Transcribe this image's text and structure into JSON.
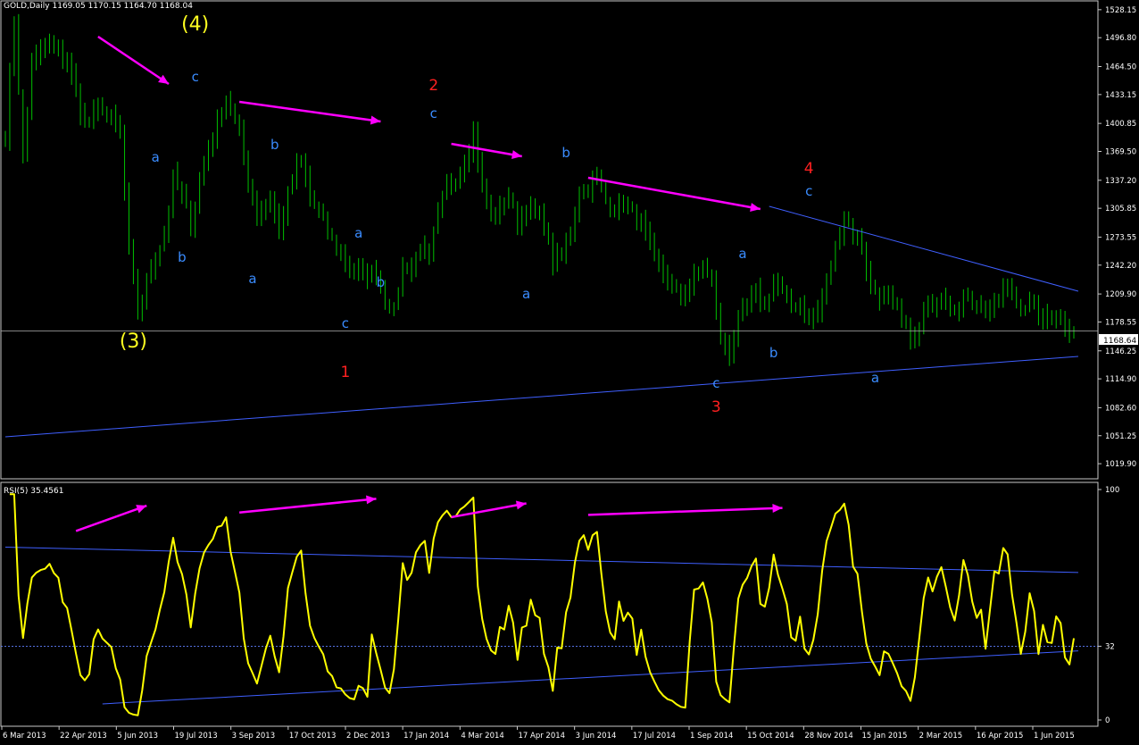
{
  "main_header": "GOLD,Daily  1169.05 1170.15 1164.70 1168.04",
  "rsi_header": "RSI(5) 35.4561",
  "current_price_label": "1168.64",
  "colors": {
    "background": "#000000",
    "candles": "#00c000",
    "rsi_line": "#ffff00",
    "trend_lines": "#3f5fff",
    "arrows": "#ff00ff",
    "wave_blue": "#3a8cff",
    "wave_red": "#ff2020",
    "wave_yellow": "#ffff20",
    "axis_text": "#ffffff",
    "frame": "#c8c8c8"
  },
  "chart_data": [
    {
      "type": "candlestick",
      "title": "GOLD,Daily",
      "y_ticks": [
        "1528.15",
        "1496.80",
        "1464.50",
        "1433.15",
        "1400.85",
        "1369.50",
        "1337.20",
        "1305.85",
        "1273.55",
        "1242.20",
        "1209.90",
        "1178.55",
        "1146.25",
        "1114.90",
        "1082.60",
        "1051.25",
        "1019.90"
      ],
      "ylim": [
        1004,
        1536
      ],
      "x_ticks": [
        "6 Mar 2013",
        "22 Apr 2013",
        "5 Jun 2013",
        "19 Jul 2013",
        "3 Sep 2013",
        "17 Oct 2013",
        "2 Dec 2013",
        "17 Jan 2014",
        "4 Mar 2014",
        "17 Apr 2014",
        "3 Jun 2014",
        "17 Jul 2014",
        "1 Sep 2014",
        "15 Oct 2014",
        "28 Nov 2014",
        "15 Jan 2015",
        "2 Mar 2015",
        "16 Apr 2015",
        "1 Jun 2015"
      ],
      "price_path": [
        [
          0,
          1390
        ],
        [
          2,
          1520
        ],
        [
          4,
          1360
        ],
        [
          6,
          1470
        ],
        [
          10,
          1490
        ],
        [
          14,
          1470
        ],
        [
          18,
          1400
        ],
        [
          22,
          1420
        ],
        [
          26,
          1390
        ],
        [
          28,
          1260
        ],
        [
          30,
          1190
        ],
        [
          33,
          1240
        ],
        [
          36,
          1275
        ],
        [
          38,
          1340
        ],
        [
          40,
          1320
        ],
        [
          42,
          1290
        ],
        [
          45,
          1360
        ],
        [
          48,
          1400
        ],
        [
          50,
          1430
        ],
        [
          53,
          1390
        ],
        [
          55,
          1340
        ],
        [
          57,
          1300
        ],
        [
          60,
          1320
        ],
        [
          62,
          1280
        ],
        [
          65,
          1340
        ],
        [
          67,
          1360
        ],
        [
          69,
          1320
        ],
        [
          72,
          1290
        ],
        [
          75,
          1260
        ],
        [
          78,
          1240
        ],
        [
          81,
          1230
        ],
        [
          84,
          1235
        ],
        [
          86,
          1205
        ],
        [
          88,
          1190
        ],
        [
          90,
          1240
        ],
        [
          92,
          1240
        ],
        [
          94,
          1265
        ],
        [
          96,
          1250
        ],
        [
          98,
          1300
        ],
        [
          100,
          1330
        ],
        [
          102,
          1340
        ],
        [
          104,
          1360
        ],
        [
          106,
          1390
        ],
        [
          108,
          1330
        ],
        [
          110,
          1300
        ],
        [
          112,
          1305
        ],
        [
          114,
          1320
        ],
        [
          116,
          1290
        ],
        [
          118,
          1305
        ],
        [
          120,
          1300
        ],
        [
          122,
          1290
        ],
        [
          124,
          1245
        ],
        [
          126,
          1255
        ],
        [
          128,
          1280
        ],
        [
          130,
          1325
        ],
        [
          132,
          1330
        ],
        [
          134,
          1340
        ],
        [
          136,
          1315
        ],
        [
          138,
          1305
        ],
        [
          140,
          1310
        ],
        [
          142,
          1300
        ],
        [
          144,
          1290
        ],
        [
          146,
          1260
        ],
        [
          148,
          1240
        ],
        [
          150,
          1230
        ],
        [
          152,
          1210
        ],
        [
          154,
          1210
        ],
        [
          156,
          1230
        ],
        [
          158,
          1240
        ],
        [
          160,
          1225
        ],
        [
          162,
          1160
        ],
        [
          164,
          1145
        ],
        [
          166,
          1180
        ],
        [
          168,
          1200
        ],
        [
          170,
          1210
        ],
        [
          172,
          1195
        ],
        [
          174,
          1225
        ],
        [
          176,
          1210
        ],
        [
          178,
          1195
        ],
        [
          180,
          1200
        ],
        [
          182,
          1180
        ],
        [
          184,
          1190
        ],
        [
          186,
          1220
        ],
        [
          188,
          1260
        ],
        [
          190,
          1300
        ],
        [
          192,
          1280
        ],
        [
          194,
          1260
        ],
        [
          196,
          1220
        ],
        [
          198,
          1210
        ],
        [
          200,
          1205
        ],
        [
          202,
          1190
        ],
        [
          204,
          1170
        ],
        [
          206,
          1160
        ],
        [
          208,
          1185
        ],
        [
          210,
          1200
        ],
        [
          212,
          1210
        ],
        [
          214,
          1200
        ],
        [
          216,
          1195
        ],
        [
          218,
          1210
        ],
        [
          220,
          1200
        ],
        [
          222,
          1190
        ],
        [
          224,
          1200
        ],
        [
          226,
          1215
        ],
        [
          228,
          1210
        ],
        [
          230,
          1195
        ],
        [
          232,
          1200
        ],
        [
          234,
          1185
        ],
        [
          236,
          1180
        ],
        [
          238,
          1190
        ],
        [
          240,
          1175
        ],
        [
          242,
          1170
        ]
      ],
      "n_bars": 243,
      "current_price": 1168.64,
      "wave_labels": [
        {
          "text": "(4)",
          "bar": 43,
          "price": 1505,
          "color": "yellow"
        },
        {
          "text": "(3)",
          "bar": 29,
          "price": 1150,
          "color": "yellow"
        },
        {
          "text": "c",
          "bar": 43,
          "price": 1448,
          "color": "blue"
        },
        {
          "text": "a",
          "bar": 34,
          "price": 1358,
          "color": "blue"
        },
        {
          "text": "b",
          "bar": 40,
          "price": 1246,
          "color": "blue"
        },
        {
          "text": "a",
          "bar": 56,
          "price": 1222,
          "color": "blue"
        },
        {
          "text": "b",
          "bar": 61,
          "price": 1372,
          "color": "blue"
        },
        {
          "text": "a",
          "bar": 80,
          "price": 1273,
          "color": "blue"
        },
        {
          "text": "b",
          "bar": 85,
          "price": 1218,
          "color": "blue"
        },
        {
          "text": "c",
          "bar": 77,
          "price": 1172,
          "color": "blue"
        },
        {
          "text": "1",
          "bar": 77,
          "price": 1117,
          "color": "red"
        },
        {
          "text": "2",
          "bar": 97,
          "price": 1438,
          "color": "red"
        },
        {
          "text": "c",
          "bar": 97,
          "price": 1407,
          "color": "blue"
        },
        {
          "text": "a",
          "bar": 118,
          "price": 1205,
          "color": "blue"
        },
        {
          "text": "b",
          "bar": 127,
          "price": 1363,
          "color": "blue"
        },
        {
          "text": "a",
          "bar": 167,
          "price": 1250,
          "color": "blue"
        },
        {
          "text": "b",
          "bar": 174,
          "price": 1139,
          "color": "blue"
        },
        {
          "text": "c",
          "bar": 161,
          "price": 1105,
          "color": "blue"
        },
        {
          "text": "3",
          "bar": 161,
          "price": 1078,
          "color": "red"
        },
        {
          "text": "4",
          "bar": 182,
          "price": 1345,
          "color": "red"
        },
        {
          "text": "c",
          "bar": 182,
          "price": 1320,
          "color": "blue"
        },
        {
          "text": "a",
          "bar": 197,
          "price": 1111,
          "color": "blue"
        }
      ],
      "trend_lines": [
        {
          "from": [
            0,
            1050
          ],
          "to": [
            243,
            1140
          ]
        },
        {
          "from": [
            173,
            1308
          ],
          "to": [
            243,
            1213
          ]
        }
      ],
      "arrows": [
        {
          "from": [
            21,
            1498
          ],
          "to": [
            37,
            1445
          ]
        },
        {
          "from": [
            53,
            1425
          ],
          "to": [
            85,
            1403
          ]
        },
        {
          "from": [
            101,
            1378
          ],
          "to": [
            117,
            1364
          ]
        },
        {
          "from": [
            132,
            1340
          ],
          "to": [
            171,
            1305
          ]
        }
      ]
    },
    {
      "type": "line",
      "title": "RSI(5)",
      "value": 35.4561,
      "ylim": [
        0,
        100
      ],
      "y_ticks": [
        "100",
        "32",
        "0"
      ],
      "reference_level": 32,
      "series_seed": 7,
      "trend_lines": [
        {
          "from": [
            0,
            75
          ],
          "to": [
            243,
            64
          ]
        },
        {
          "from": [
            22,
            7
          ],
          "to": [
            243,
            30
          ]
        }
      ],
      "arrows": [
        {
          "from": [
            16,
            82
          ],
          "to": [
            32,
            93
          ]
        },
        {
          "from": [
            53,
            90
          ],
          "to": [
            84,
            96
          ]
        },
        {
          "from": [
            101,
            88
          ],
          "to": [
            118,
            94
          ]
        },
        {
          "from": [
            132,
            89
          ],
          "to": [
            176,
            92
          ]
        }
      ]
    }
  ]
}
